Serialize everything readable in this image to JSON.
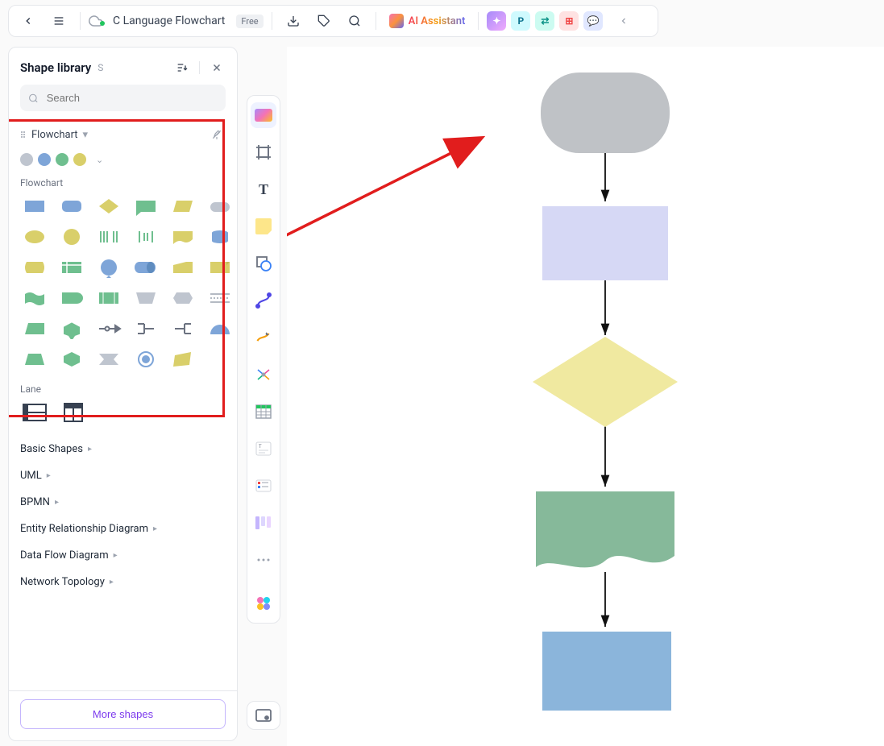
{
  "topbar": {
    "doc_title": "C Language Flowchart",
    "badge": "Free",
    "ai_label": "AI Assistant",
    "mini_apps": [
      {
        "bg": "linear-gradient(135deg,#a78bfa,#f0abfc)",
        "glyph": "✦",
        "fg": "#fff"
      },
      {
        "bg": "#cffafe",
        "glyph": "P",
        "fg": "#0e7490"
      },
      {
        "bg": "#ccfbf1",
        "glyph": "⇄",
        "fg": "#0d9488"
      },
      {
        "bg": "#fee2e2",
        "glyph": "⊞",
        "fg": "#ef4444"
      },
      {
        "bg": "#e0e7ff",
        "glyph": "💬",
        "fg": "#6366f1"
      }
    ]
  },
  "sidebar": {
    "title": "Shape library",
    "hotkey": "S",
    "search_placeholder": "Search",
    "flowchart_cat": "Flowchart",
    "colors": [
      "#bfc5cf",
      "#7ea5d8",
      "#6fbf8f",
      "#d9cf6a"
    ],
    "flowchart_label": "Flowchart",
    "lane_label": "Lane",
    "categories": [
      "Basic Shapes",
      "UML",
      "BPMN",
      "Entity Relationship Diagram",
      "Data Flow Diagram",
      "Network Topology"
    ],
    "more_shapes": "More shapes"
  },
  "canvas": {
    "shapes": [
      {
        "type": "terminator",
        "fill": "#bfc2c6"
      },
      {
        "type": "process",
        "fill": "#d6d8f5"
      },
      {
        "type": "decision",
        "fill": "#f0e9a0"
      },
      {
        "type": "document",
        "fill": "#86b99a"
      },
      {
        "type": "process",
        "fill": "#8bb5db"
      }
    ]
  }
}
